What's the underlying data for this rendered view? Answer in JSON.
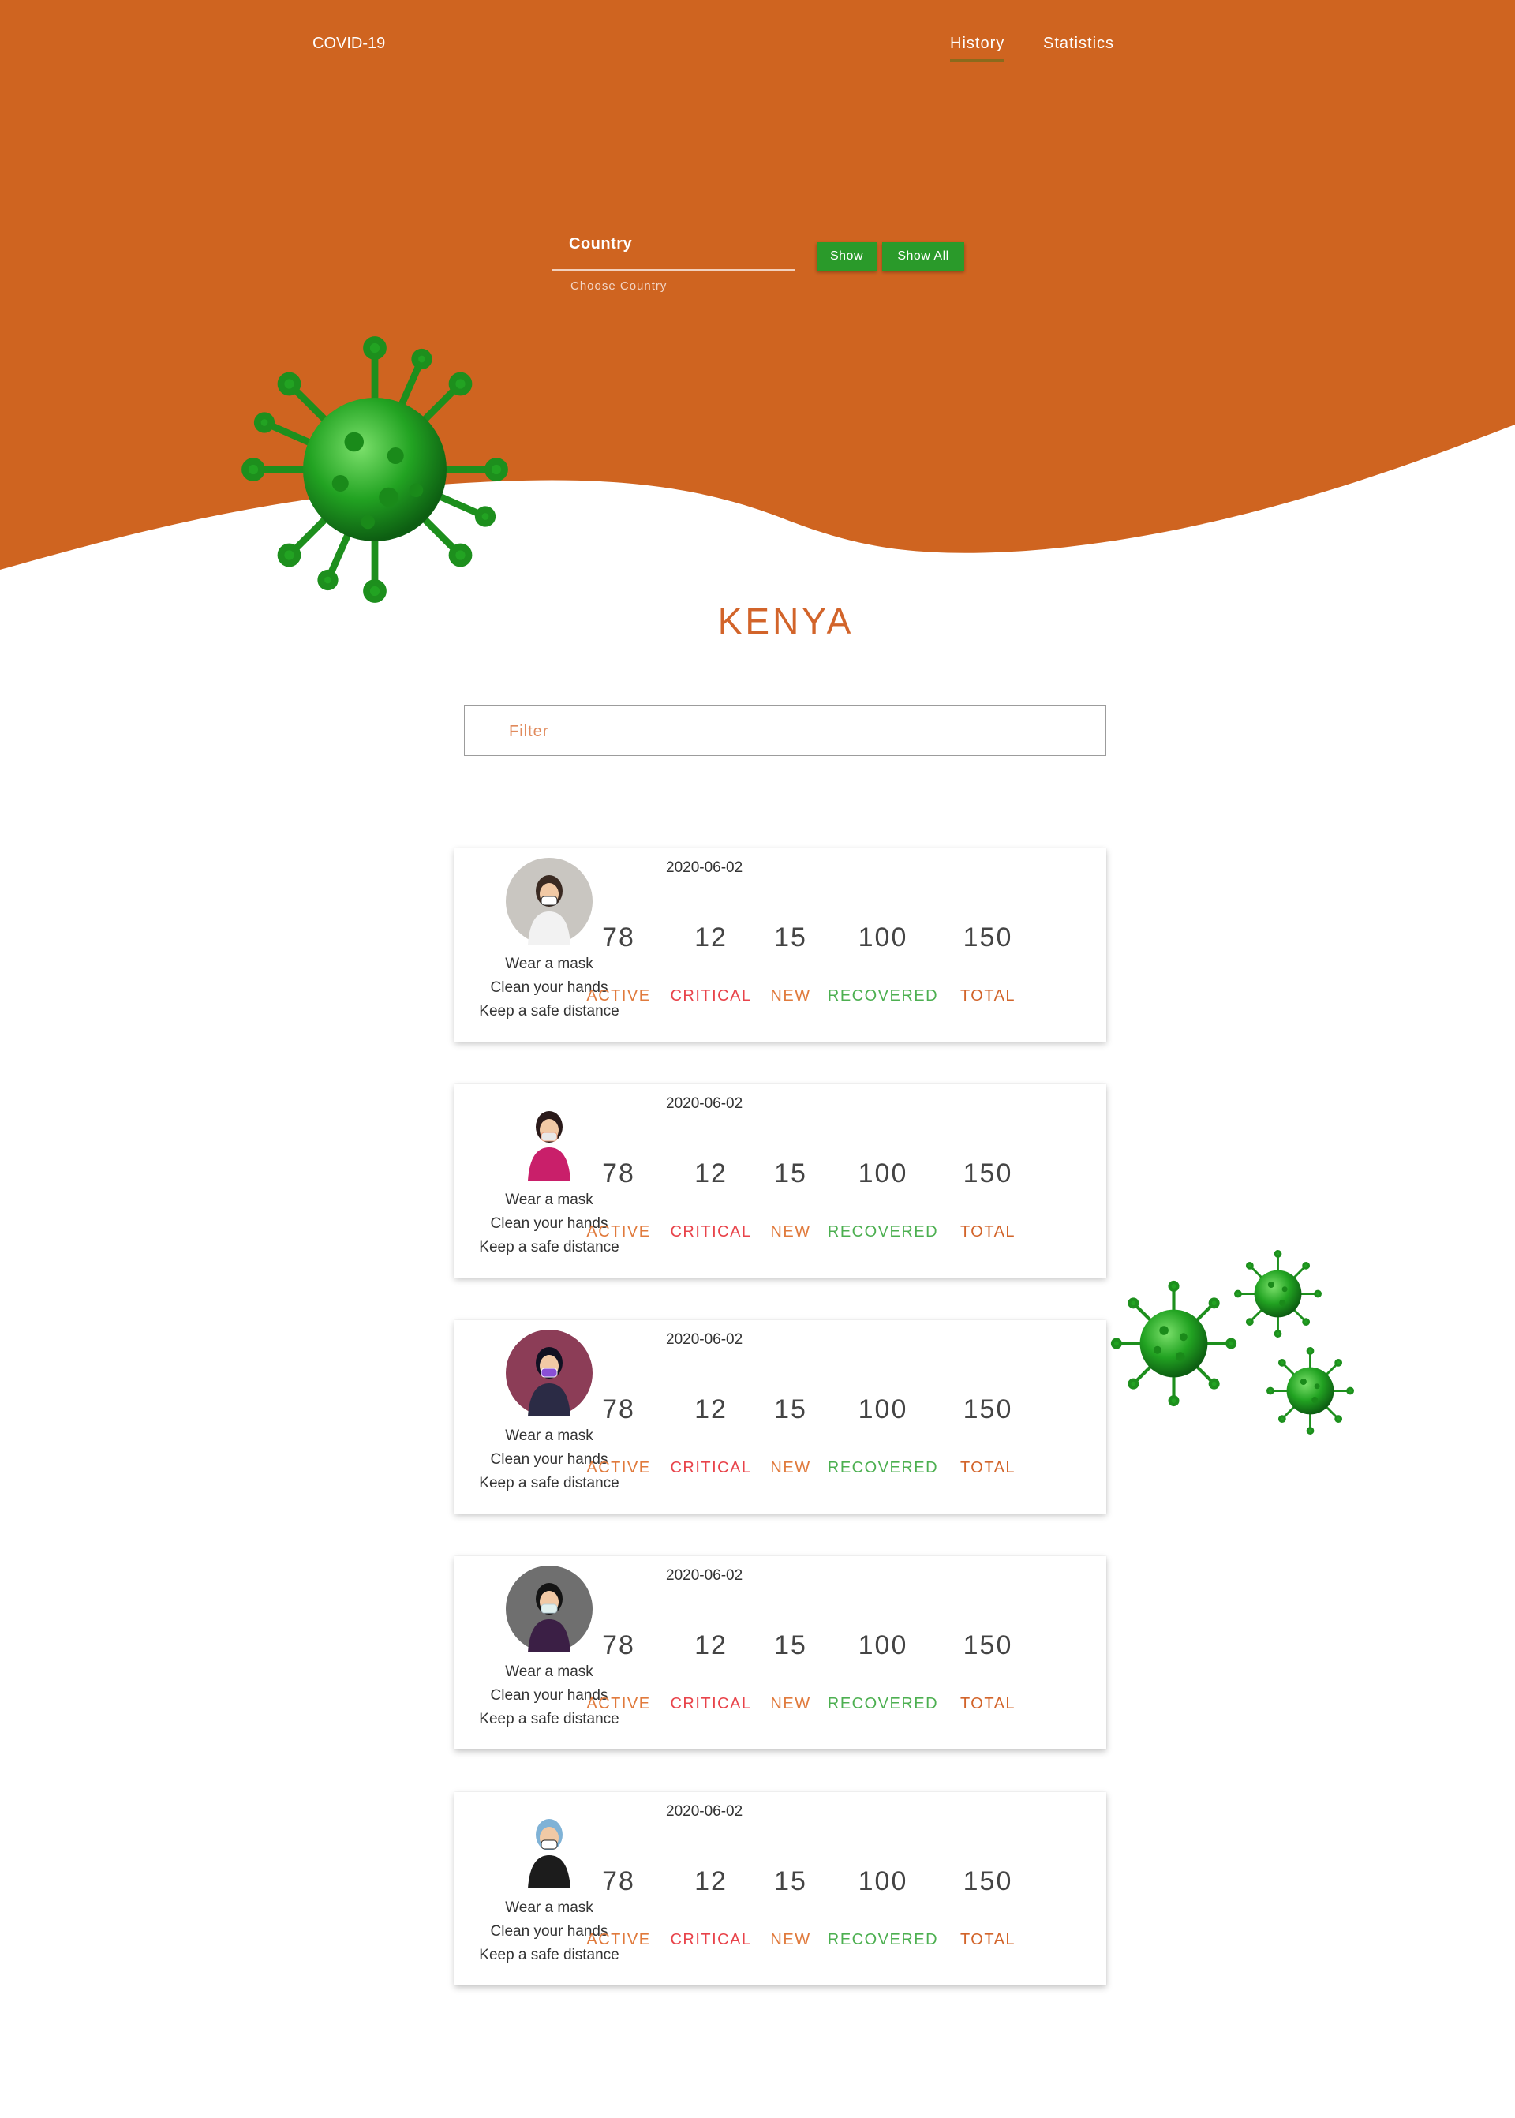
{
  "nav": {
    "brand": "COVID-19",
    "links": [
      {
        "label": "History",
        "active": true
      },
      {
        "label": "Statistics",
        "active": false
      }
    ]
  },
  "search": {
    "country_label": "Country",
    "helper": "Choose Country",
    "show_label": "Show",
    "show_all_label": "Show All"
  },
  "country_title": "KENYA",
  "filter": {
    "placeholder": "Filter"
  },
  "cards": [
    {
      "date": "2020-06-02",
      "tips": [
        "Wear a mask",
        "Clean your hands",
        "Keep a safe distance"
      ],
      "avatar": "person-with-mask-icon",
      "stats": [
        {
          "value": "78",
          "label": "ACTIVE"
        },
        {
          "value": "12",
          "label": "CRITICAL"
        },
        {
          "value": "15",
          "label": "NEW"
        },
        {
          "value": "100",
          "label": "RECOVERED"
        },
        {
          "value": "150",
          "label": "TOTAL"
        }
      ]
    },
    {
      "date": "2020-06-02",
      "tips": [
        "Wear a mask",
        "Clean your hands",
        "Keep a safe distance"
      ],
      "avatar": "person-with-sign-icon",
      "stats": [
        {
          "value": "78",
          "label": "ACTIVE"
        },
        {
          "value": "12",
          "label": "CRITICAL"
        },
        {
          "value": "15",
          "label": "NEW"
        },
        {
          "value": "100",
          "label": "RECOVERED"
        },
        {
          "value": "150",
          "label": "TOTAL"
        }
      ]
    },
    {
      "date": "2020-06-02",
      "tips": [
        "Wear a mask",
        "Clean your hands",
        "Keep a safe distance"
      ],
      "avatar": "woman-purple-mask-icon",
      "stats": [
        {
          "value": "78",
          "label": "ACTIVE"
        },
        {
          "value": "12",
          "label": "CRITICAL"
        },
        {
          "value": "15",
          "label": "NEW"
        },
        {
          "value": "100",
          "label": "RECOVERED"
        },
        {
          "value": "150",
          "label": "TOTAL"
        }
      ]
    },
    {
      "date": "2020-06-02",
      "tips": [
        "Wear a mask",
        "Clean your hands",
        "Keep a safe distance"
      ],
      "avatar": "woman-street-mask-icon",
      "stats": [
        {
          "value": "78",
          "label": "ACTIVE"
        },
        {
          "value": "12",
          "label": "CRITICAL"
        },
        {
          "value": "15",
          "label": "NEW"
        },
        {
          "value": "100",
          "label": "RECOVERED"
        },
        {
          "value": "150",
          "label": "TOTAL"
        }
      ]
    },
    {
      "date": "2020-06-02",
      "tips": [
        "Wear a mask",
        "Clean your hands",
        "Keep a safe distance"
      ],
      "avatar": "woman-striped-mask-icon",
      "stats": [
        {
          "value": "78",
          "label": "ACTIVE"
        },
        {
          "value": "12",
          "label": "CRITICAL"
        },
        {
          "value": "15",
          "label": "NEW"
        },
        {
          "value": "100",
          "label": "RECOVERED"
        },
        {
          "value": "150",
          "label": "TOTAL"
        }
      ]
    }
  ],
  "colors": {
    "primary": "#d2642a",
    "button": "#2a9a2a",
    "active": "#e07a3c",
    "critical": "#e8434a",
    "new": "#e07a3c",
    "recovered": "#4caf50",
    "total": "#d2642a",
    "virus": "#22a322"
  }
}
